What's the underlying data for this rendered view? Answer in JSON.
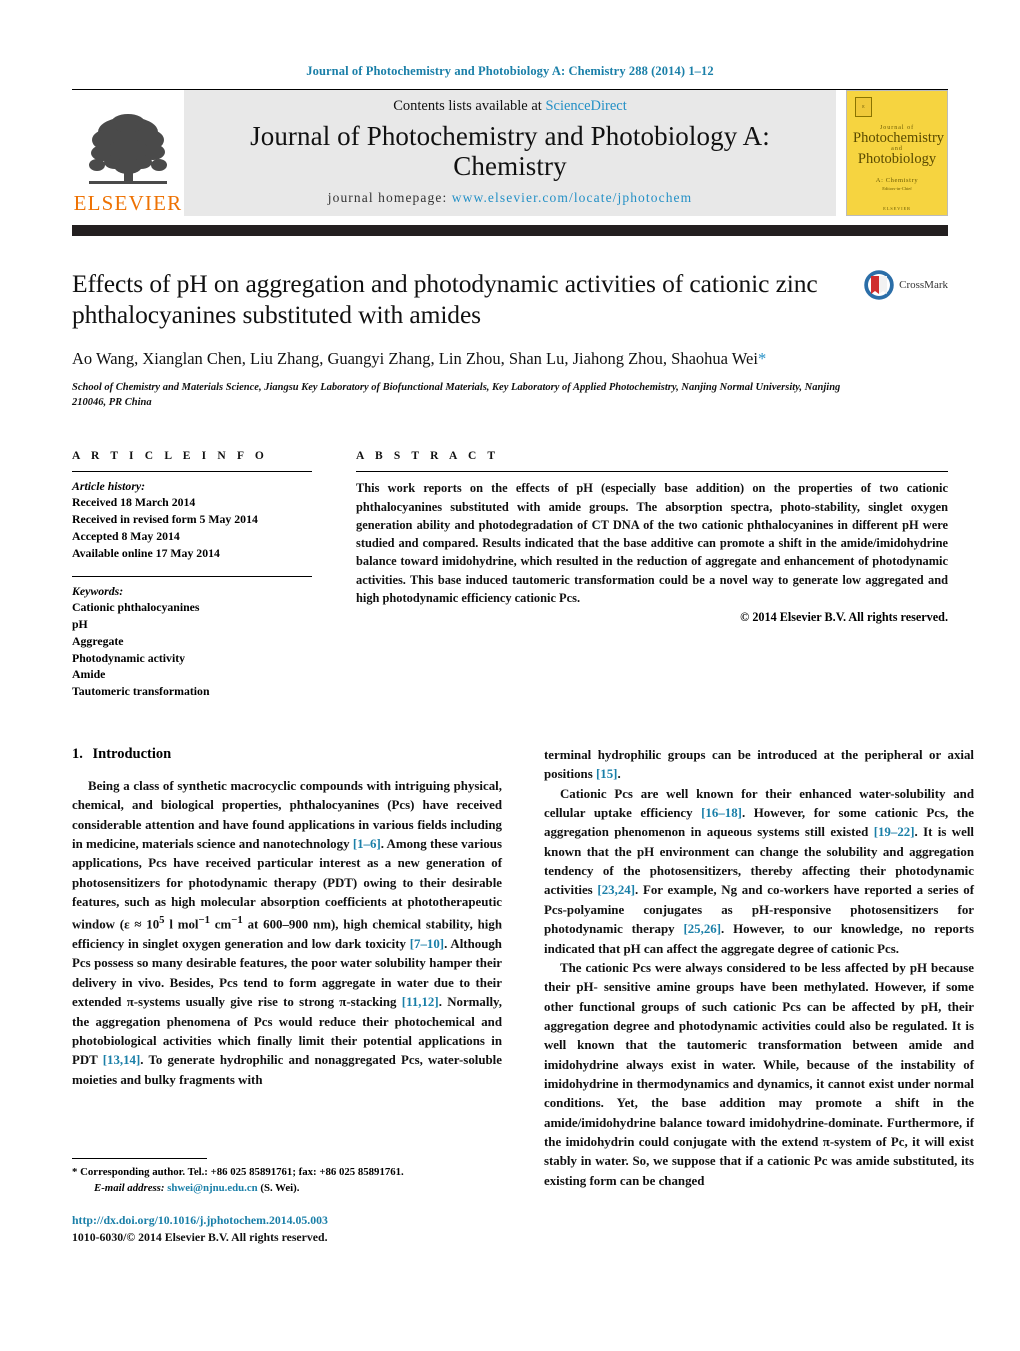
{
  "running_head": "Journal of Photochemistry and Photobiology A: Chemistry 288 (2014) 1–12",
  "masthead": {
    "contents_prefix": "Contents lists available at ",
    "sciencedirect": "ScienceDirect",
    "journal_title": "Journal of Photochemistry and Photobiology A: Chemistry",
    "homepage_label": "journal homepage:",
    "homepage_url": "www.elsevier.com/locate/jphotochem",
    "publisher_wordmark": "ELSEVIER",
    "cover": {
      "small_top": "Journal of",
      "line1": "Photochemistry",
      "and": "and",
      "line2": "Photobiology",
      "sub": "A: Chemistry",
      "sub2": "Editors-in-Chief",
      "foot": "ELSEVIER"
    }
  },
  "article": {
    "title": "Effects of pH on aggregation and photodynamic activities of cationic zinc phthalocyanines substituted with amides",
    "crossmark_label": "CrossMark",
    "authors": "Ao Wang, Xianglan Chen, Liu Zhang, Guangyi Zhang, Lin Zhou, Shan Lu, Jiahong Zhou, Shaohua Wei",
    "author_marker": "*",
    "affiliation": "School of Chemistry and Materials Science, Jiangsu Key Laboratory of Biofunctional Materials, Key Laboratory of Applied Photochemistry, Nanjing Normal University, Nanjing 210046, PR China"
  },
  "article_info": {
    "heading": "A R T I C L E   I N F O",
    "history_label": "Article history:",
    "history": [
      "Received 18 March 2014",
      "Received in revised form 5 May 2014",
      "Accepted 8 May 2014",
      "Available online 17 May 2014"
    ],
    "keywords_label": "Keywords:",
    "keywords": [
      "Cationic phthalocyanines",
      "pH",
      "Aggregate",
      "Photodynamic activity",
      "Amide",
      "Tautomeric transformation"
    ]
  },
  "abstract": {
    "heading": "A B S T R A C T",
    "text": "This work reports on the effects of pH (especially base addition) on the properties of two cationic phthalocyanines substituted with amide groups. The absorption spectra, photo-stability, singlet oxygen generation ability and photodegradation of CT DNA of the two cationic phthalocyanines in different pH were studied and compared. Results indicated that the base additive can promote a shift in the amide/imidohydrine balance toward imidohydrine, which resulted in the reduction of aggregate and enhancement of photodynamic activities. This base induced tautomeric transformation could be a novel way to generate low aggregated and high photodynamic efficiency cationic Pcs.",
    "copyright": "© 2014 Elsevier B.V. All rights reserved."
  },
  "introduction": {
    "section_number": "1.",
    "section_title": "Introduction",
    "left_paragraph_1_a": "Being a class of synthetic macrocyclic compounds with intriguing physical, chemical, and biological properties, phthalocyanines (Pcs) have received considerable attention and have found applications in various fields including in medicine, materials science and nanotechnology ",
    "ref_1_6": "[1–6]",
    "left_paragraph_1_b": ". Among these various applications, Pcs have received particular interest as a new generation of photosensitizers for photodynamic therapy (PDT) owing to their desirable features, such as high molecular absorption coefficients at phototherapeutic window (ε ≈ 10",
    "sup_5": "5",
    "left_paragraph_1_c": " l mol",
    "sup_m1a": "−1",
    "left_paragraph_1_d": " cm",
    "sup_m1b": "−1",
    "left_paragraph_1_e": " at 600–900 nm), high chemical stability, high efficiency in singlet oxygen generation and low dark toxicity ",
    "ref_7_10": "[7–10]",
    "left_paragraph_1_f": ". Although Pcs possess so many desirable features, the poor water solubility hamper their delivery in vivo. Besides, Pcs tend to form aggregate in water due to their extended π-systems usually give rise to strong π-stacking ",
    "ref_11_12": "[11,12]",
    "left_paragraph_1_g": ". Normally, the aggregation phenomena of Pcs would reduce their photochemical and photobiological activities which finally limit their potential applications in PDT ",
    "ref_13_14": "[13,14]",
    "left_paragraph_1_h": ". To generate hydrophilic and nonaggregated Pcs, water-soluble moieties and bulky fragments with",
    "right_continuation_a": "terminal hydrophilic groups can be introduced at the peripheral or axial positions ",
    "ref_15": "[15]",
    "right_continuation_b": ".",
    "right_paragraph_2_a": "Cationic Pcs are well known for their enhanced water-solubility and cellular uptake efficiency ",
    "ref_16_18": "[16–18]",
    "right_paragraph_2_b": ". However, for some cationic Pcs, the aggregation phenomenon in aqueous systems still existed ",
    "ref_19_22": "[19–22]",
    "right_paragraph_2_c": ". It is well known that the pH environment can change the solubility and aggregation tendency of the photosensitizers, thereby affecting their photodynamic activities ",
    "ref_23_24": "[23,24]",
    "right_paragraph_2_d": ". For example, Ng and co-workers have reported a series of Pcs-polyamine conjugates as pH-responsive photosensitizers for photodynamic therapy ",
    "ref_25_26": "[25,26]",
    "right_paragraph_2_e": ". However, to our knowledge, no reports indicated that pH can affect the aggregate degree of cationic Pcs.",
    "right_paragraph_3": "The cationic Pcs were always considered to be less affected by pH because their pH- sensitive amine groups have been methylated. However, if some other functional groups of such cationic Pcs can be affected by pH, their aggregation degree and photodynamic activities could also be regulated. It is well known that the tautomeric transformation between amide and imidohydrine always exist in water. While, because of the instability of imidohydrine in thermodynamics and dynamics, it cannot exist under normal conditions. Yet, the base addition may promote a shift in the amide/imidohydrine balance toward imidohydrine-dominate. Furthermore, if the imidohydrin could conjugate with the extend π-system of Pc, it will exist stably in water. So, we suppose that if a cationic Pc was amide substituted, its existing form can be changed"
  },
  "footer": {
    "corresponding_marker": "*",
    "corresponding_text": "Corresponding author. Tel.: +86 025 85891761; fax: +86 025 85891761.",
    "email_label": "E-mail address:",
    "email": "shwei@njnu.edu.cn",
    "email_suffix": "(S. Wei).",
    "doi": "http://dx.doi.org/10.1016/j.jphotochem.2014.05.003",
    "issn_line": "1010-6030/© 2014 Elsevier B.V. All rights reserved."
  },
  "colors": {
    "link": "#1a7fa8",
    "sciencedirect": "#2490c6",
    "elsevier_orange": "#ee7203",
    "cover_yellow": "#f6d440",
    "bar_black": "#231f20"
  }
}
